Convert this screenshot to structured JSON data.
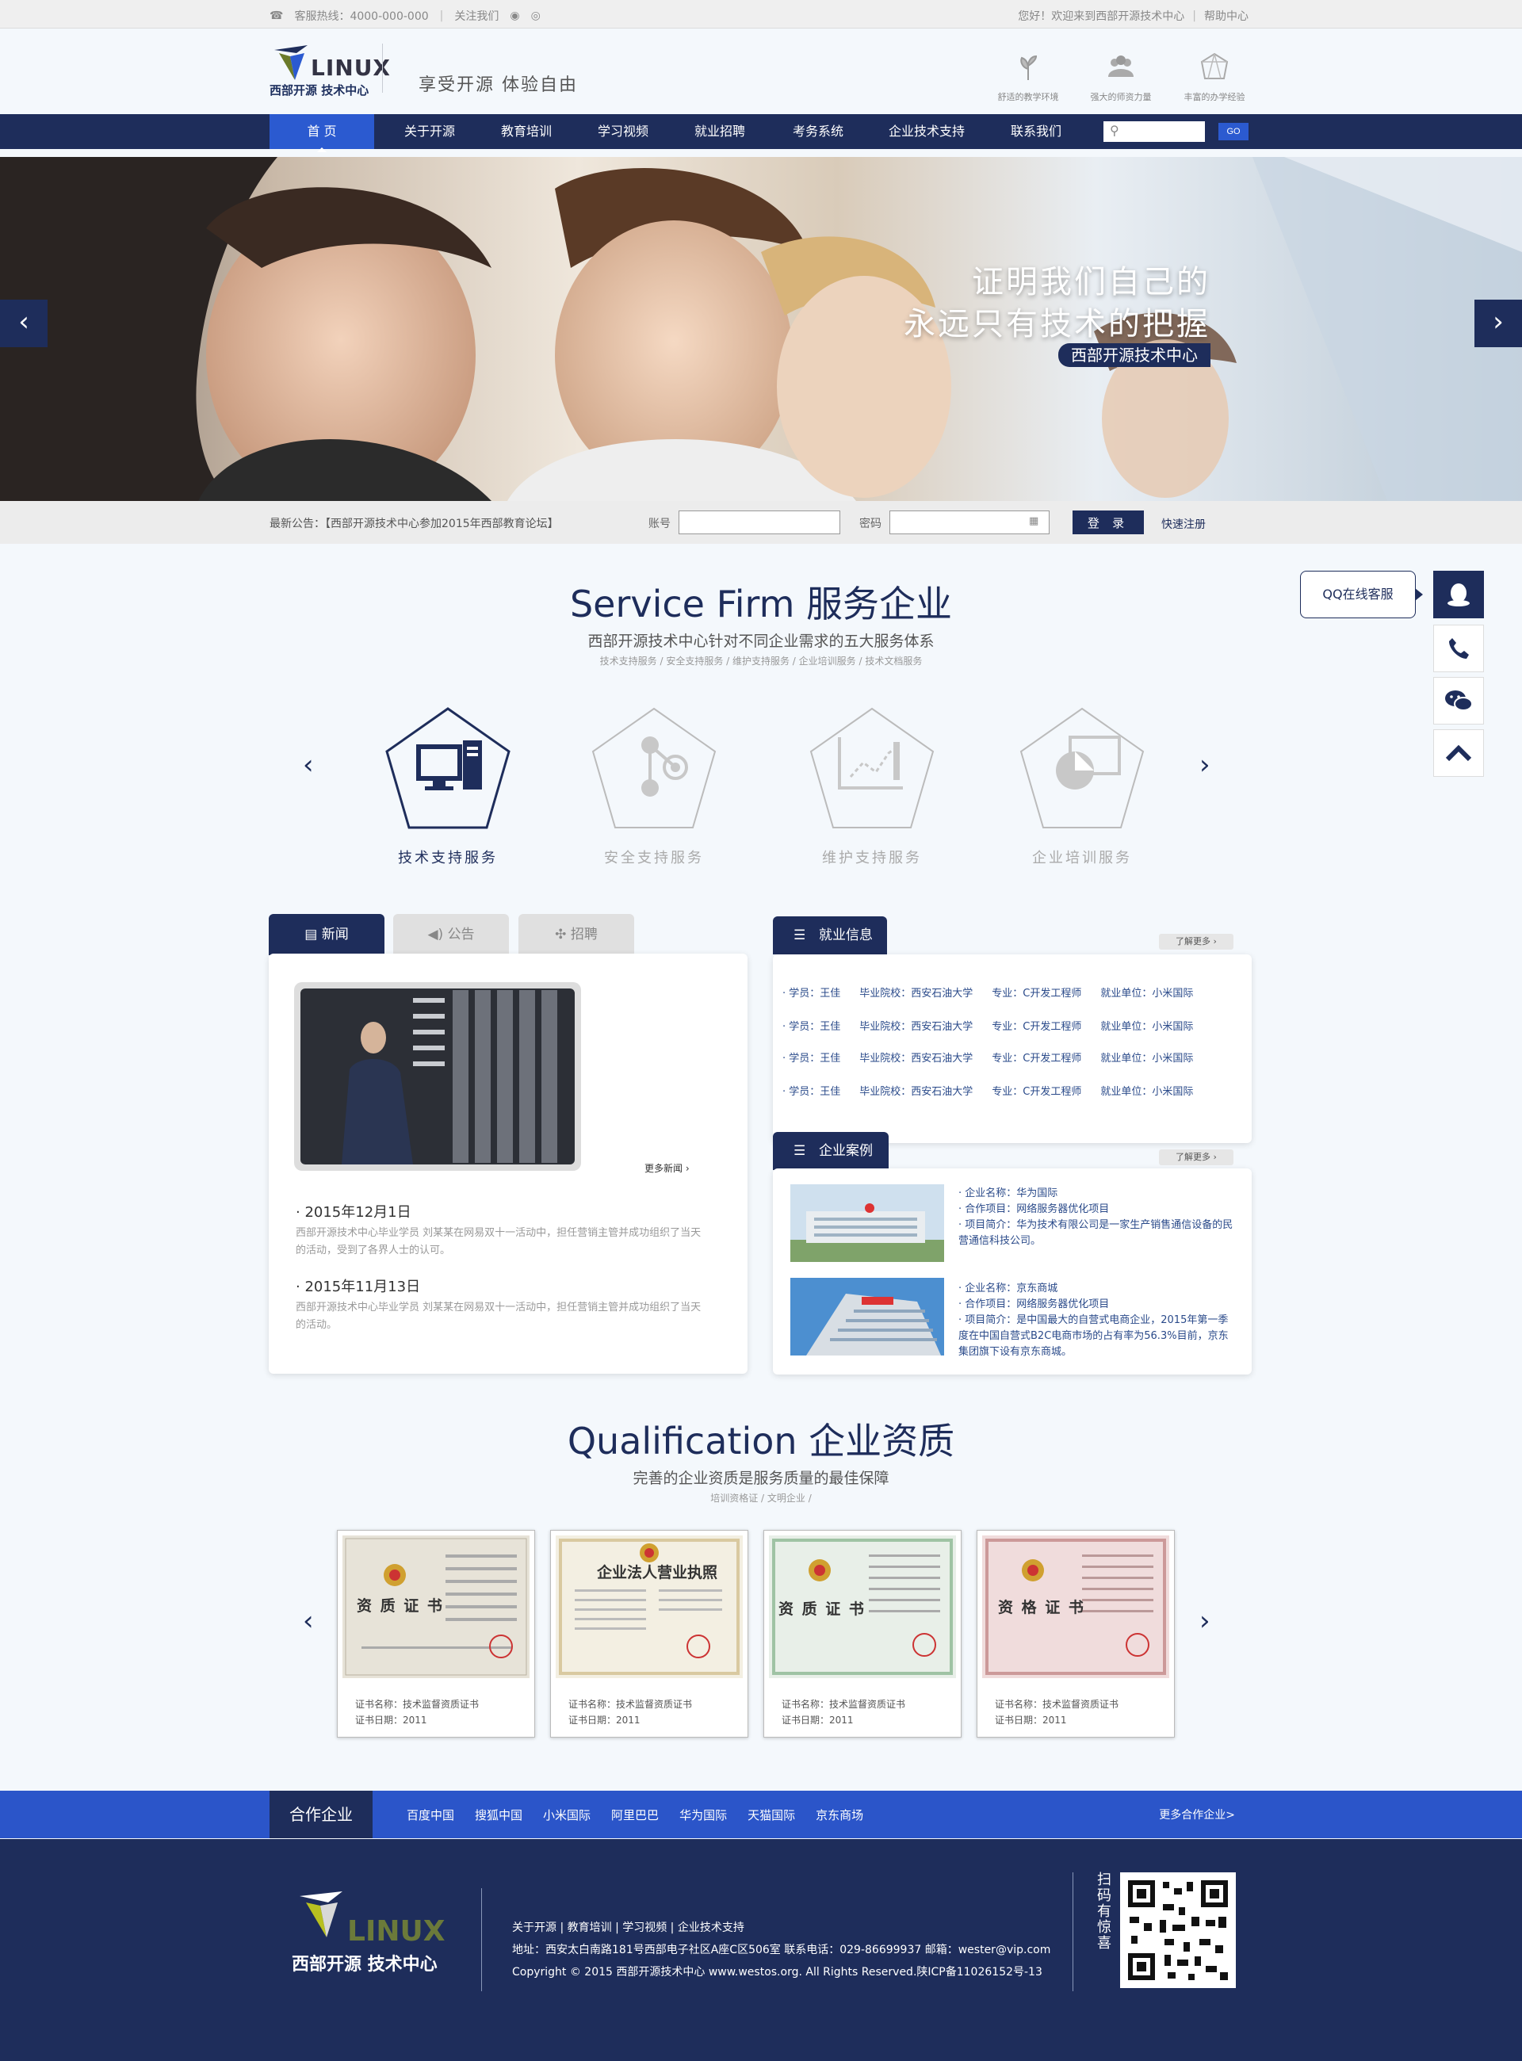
{
  "topbar": {
    "hotline": "客服热线：4000-000-000",
    "follow": "关注我们",
    "welcome": "您好！欢迎来到西部开源技术中心",
    "help": "帮助中心"
  },
  "header": {
    "logo_word": "LINUX",
    "logo_sub": "西部开源 技术中心",
    "slogan": "享受开源  体验自由",
    "features": [
      "舒适的教学环境",
      "强大的师资力量",
      "丰富的办学经验"
    ]
  },
  "nav": {
    "items": [
      "首  页",
      "关于开源",
      "教育培训",
      "学习视频",
      "就业招聘",
      "考务系统",
      "企业技术支持",
      "联系我们"
    ],
    "go_label": "GO"
  },
  "banner": {
    "line1": "证明我们自己的",
    "line2": "永远只有技术的把握",
    "tag": "西部开源技术中心"
  },
  "notice": {
    "announcement": "最新公告：【西部开源技术中心参加2015年西部教育论坛】",
    "account_label": "账号",
    "password_label": "密码",
    "login_label": "登 录",
    "register_label": "快速注册"
  },
  "service": {
    "title": "Service Firm 服务企业",
    "subtitle": "西部开源技术中心针对不同企业需求的五大服务体系",
    "keywords": "技术支持服务 / 安全支持服务 / 维护支持服务 / 企业培训服务 / 技术文档服务",
    "items": [
      "技术支持服务",
      "安全支持服务",
      "维护支持服务",
      "企业培训服务"
    ]
  },
  "side": {
    "qq_label": "QQ在线客服"
  },
  "news": {
    "tabs": [
      "新闻",
      "公告",
      "招聘"
    ],
    "more": "更多新闻",
    "items": [
      {
        "date": "2015年12月1日",
        "text": "西部开源技术中心毕业学员 刘某某在网易双十一活动中，担任营销主管并成功组织了当天的活动，受到了各界人士的认可。"
      },
      {
        "date": "2015年11月13日",
        "text": "西部开源技术中心毕业学员 刘某某在网易双十一活动中，担任营销主管并成功组织了当天的活动。"
      }
    ]
  },
  "jobs": {
    "title": "就业信息",
    "more": "了解更多",
    "rows": [
      [
        "· 学员：王佳",
        "毕业院校：西安石油大学",
        "专业：C开发工程师",
        "就业单位：小米国际"
      ],
      [
        "· 学员：王佳",
        "毕业院校：西安石油大学",
        "专业：C开发工程师",
        "就业单位：小米国际"
      ],
      [
        "· 学员：王佳",
        "毕业院校：西安石油大学",
        "专业：C开发工程师",
        "就业单位：小米国际"
      ],
      [
        "· 学员：王佳",
        "毕业院校：西安石油大学",
        "专业：C开发工程师",
        "就业单位：小米国际"
      ]
    ]
  },
  "cases": {
    "title": "企业案例",
    "more": "了解更多",
    "items": [
      {
        "name": "· 企业名称：华为国际",
        "project": "· 合作项目：网络服务器优化项目",
        "intro": "· 项目简介：华为技术有限公司是一家生产销售通信设备的民营通信科技公司。"
      },
      {
        "name": "· 企业名称：京东商城",
        "project": "· 合作项目：网络服务器优化项目",
        "intro": "· 项目简介：是中国最大的自营式电商企业，2015年第一季度在中国自营式B2C电商市场的占有率为56.3%目前，京东集团旗下设有京东商城。"
      }
    ]
  },
  "qualification": {
    "title": "Qualification 企业资质",
    "subtitle": "完善的企业资质是服务质量的最佳保障",
    "keywords": "培训资格证 / 文明企业 /",
    "certs": [
      {
        "stamp": "资 质 证 书",
        "name": "证书名称：技术监督资质证书",
        "date": "证书日期：2011"
      },
      {
        "stamp": "企业法人营业执照",
        "name": "证书名称：技术监督资质证书",
        "date": "证书日期：2011"
      },
      {
        "stamp": "资 质 证 书",
        "name": "证书名称：技术监督资质证书",
        "date": "证书日期：2011"
      },
      {
        "stamp": "资 格 证 书",
        "name": "证书名称：技术监督资质证书",
        "date": "证书日期：2011"
      }
    ]
  },
  "partners": {
    "label": "合作企业",
    "links": [
      "百度中国",
      "搜狐中国",
      "小米国际",
      "阿里巴巴",
      "华为国际",
      "天猫国际",
      "京东商场"
    ],
    "more": "更多合作企业>"
  },
  "footer": {
    "logo_word": "LINUX",
    "logo_sub": "西部开源 技术中心",
    "links": "关于开源 | 教育培训 | 学习视频 | 企业技术支持",
    "address": "地址：西安太白南路181号西部电子社区A座C区506室   联系电话：029-86699937   邮箱：wester@vip.com",
    "copyright": "Copyright © 2015 西部开源技术中心 www.westos.org. All Rights Reserved.陕ICP备11026152号-13",
    "qr_text": "扫码有惊喜"
  },
  "colors": {
    "navy": "#1e2d5b",
    "accent": "#2b5ad0"
  }
}
